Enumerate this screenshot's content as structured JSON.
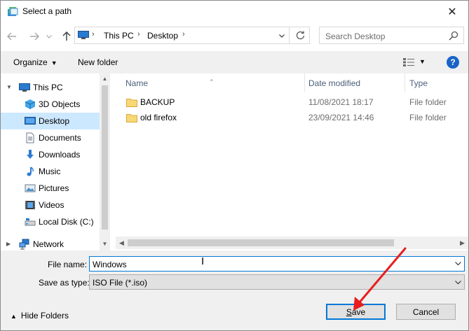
{
  "window": {
    "title": "Select a path",
    "close_glyph": "✕"
  },
  "navigation": {
    "back_icon": "back-arrow-icon",
    "forward_icon": "forward-arrow-icon",
    "recent_icon": "chevron-down-icon",
    "up_icon": "up-arrow-icon"
  },
  "address": {
    "crumbs": [
      "This PC",
      "Desktop"
    ]
  },
  "search": {
    "placeholder": "Search Desktop"
  },
  "toolbar": {
    "organize": "Organize",
    "new_folder": "New folder"
  },
  "nav_pane": {
    "items": [
      {
        "label": "This PC",
        "icon": "this-pc-icon"
      },
      {
        "label": "3D Objects",
        "icon": "3d-objects-icon"
      },
      {
        "label": "Desktop",
        "icon": "desktop-icon",
        "selected": true
      },
      {
        "label": "Documents",
        "icon": "documents-icon"
      },
      {
        "label": "Downloads",
        "icon": "downloads-icon"
      },
      {
        "label": "Music",
        "icon": "music-icon"
      },
      {
        "label": "Pictures",
        "icon": "pictures-icon"
      },
      {
        "label": "Videos",
        "icon": "videos-icon"
      },
      {
        "label": "Local Disk (C:)",
        "icon": "local-disk-icon"
      },
      {
        "label": "Network",
        "icon": "network-icon"
      }
    ]
  },
  "file_list": {
    "columns": [
      "Name",
      "Date modified",
      "Type"
    ],
    "rows": [
      {
        "name": "BACKUP",
        "date": "11/08/2021 18:17",
        "type": "File folder"
      },
      {
        "name": "old firefox",
        "date": "23/09/2021 14:46",
        "type": "File folder"
      }
    ]
  },
  "form": {
    "file_name_label": "File name:",
    "file_name_value": "Windows",
    "save_type_label": "Save as type:",
    "save_type_value": "ISO File (*.iso)"
  },
  "footer": {
    "hide_folders": "Hide Folders",
    "save_prefix": "S",
    "save_rest": "ave",
    "cancel": "Cancel"
  },
  "colors": {
    "accent": "#0078d7",
    "selection": "#cce8ff",
    "annotation_arrow": "#e81e1e"
  }
}
